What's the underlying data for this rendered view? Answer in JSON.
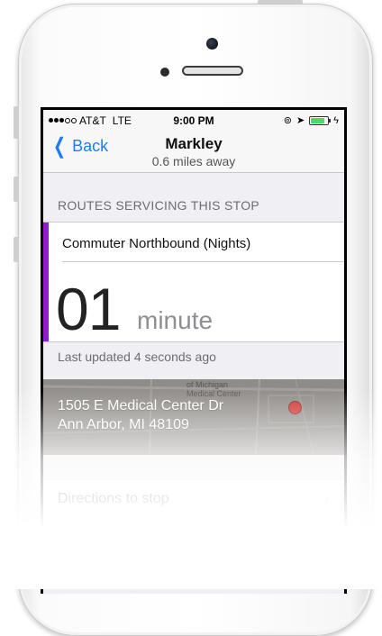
{
  "status_bar": {
    "carrier": "AT&T",
    "network": "LTE",
    "time": "9:00 PM",
    "battery_color": "#4cd964",
    "icons": [
      "signal-dots-icon",
      "lock-rotation-icon",
      "location-arrow-icon",
      "battery-icon",
      "charging-bolt-icon"
    ]
  },
  "nav": {
    "back_label": "Back",
    "title": "Markley",
    "subtitle": "0.6 miles away"
  },
  "routes_header": "ROUTES SERVICING THIS STOP",
  "route": {
    "name": "Commuter Northbound (Nights)",
    "accent_color": "#8b1fd1",
    "eta_value": "01",
    "eta_unit": "minute"
  },
  "last_updated": "Last updated 4 seconds ago",
  "map": {
    "address_line1": "1505 E Medical Center Dr",
    "address_line2": "Ann Arbor, MI 48109",
    "map_label_line1": "of Michigan",
    "map_label_line2": "Medical Center",
    "pin_color": "#d0352f"
  },
  "directions": {
    "label": "Directions to stop"
  },
  "colors": {
    "ios_blue": "#1e7ef0",
    "background": "#efeff4"
  }
}
